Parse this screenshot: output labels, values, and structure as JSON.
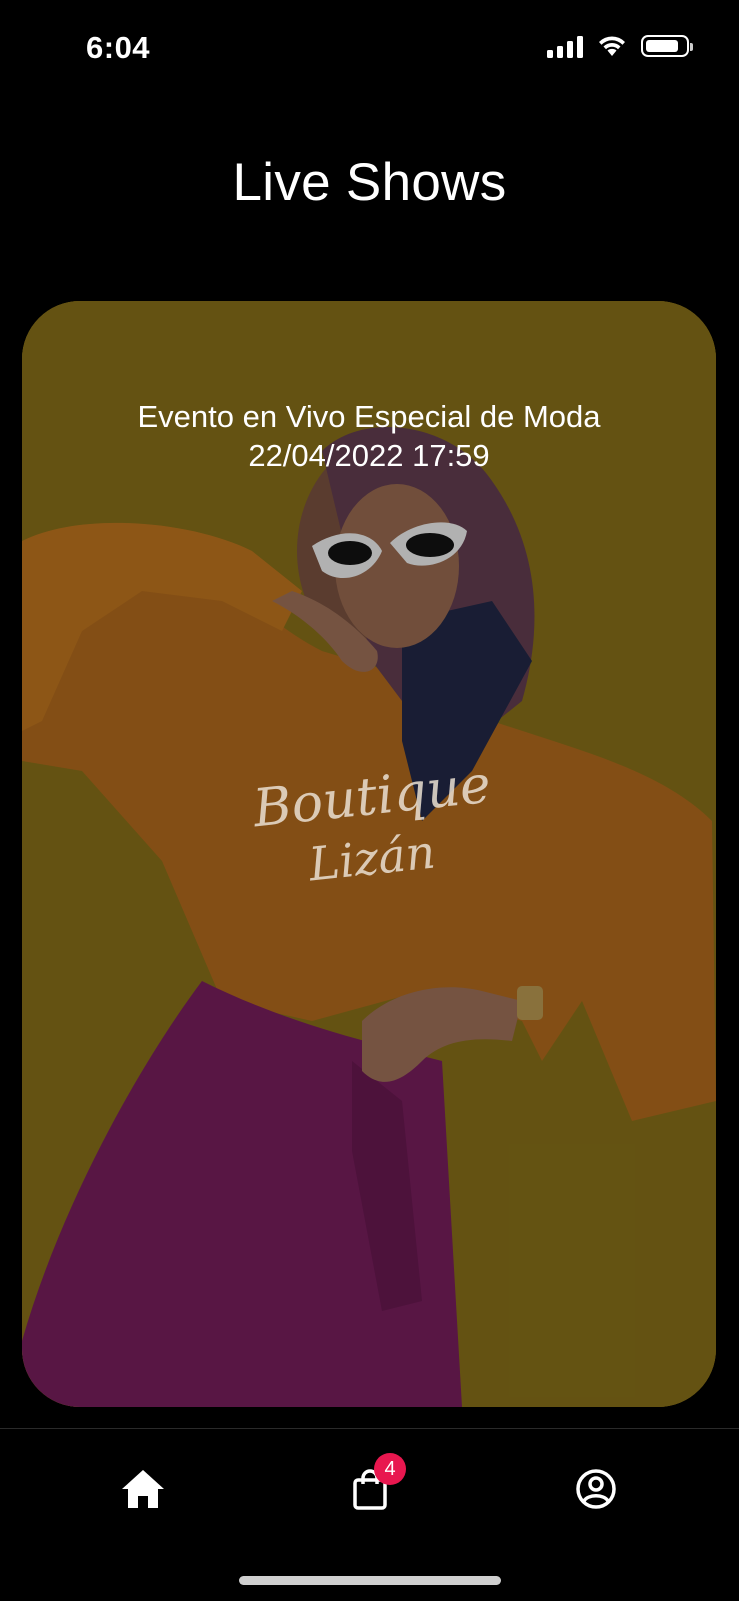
{
  "status_bar": {
    "time": "6:04",
    "icons": [
      "cellular-signal-icon",
      "wifi-icon",
      "battery-icon"
    ],
    "battery_level": 0.85
  },
  "header": {
    "title": "Live Shows"
  },
  "event": {
    "title": "Evento en Vivo Especial de Moda",
    "datetime": "22/04/2022 17:59",
    "watermark_line1": "Boutique",
    "watermark_line2": "Lizán",
    "image_description_icon": "fashion-model-photo",
    "background_color": "#7a6516"
  },
  "tab_bar": {
    "items": [
      {
        "icon": "home-icon",
        "active": true
      },
      {
        "icon": "shopping-bag-icon",
        "badge": "4",
        "active": false
      },
      {
        "icon": "profile-icon",
        "active": false
      }
    ],
    "badge_color": "#e8174f"
  }
}
